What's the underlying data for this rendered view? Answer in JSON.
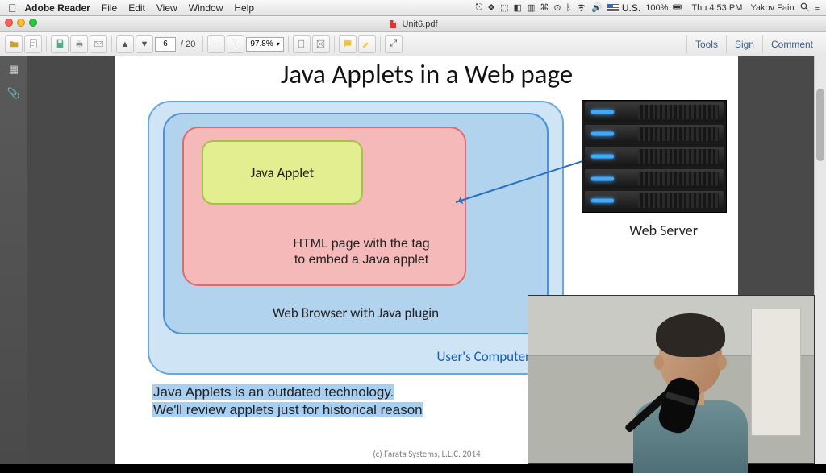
{
  "macmenu": {
    "app": "Adobe Reader",
    "items": [
      "File",
      "Edit",
      "View",
      "Window",
      "Help"
    ],
    "status": {
      "battery": "100%",
      "time": "Thu 4:53 PM",
      "user": "Yakov Fain",
      "input": "U.S."
    }
  },
  "window": {
    "title_doc": "Unit6.pdf"
  },
  "toolbar": {
    "page_current": "6",
    "page_total": "/  20",
    "zoom": "97.8%",
    "right": {
      "tools": "Tools",
      "sign": "Sign",
      "comment": "Comment"
    }
  },
  "slide": {
    "title": "Java Applets in a Web page",
    "applet_box": "Java Applet",
    "html_box_line1": "HTML page with the tag",
    "html_box_line2": "to embed a Java applet",
    "browser_label": "Web Browser with Java plugin",
    "computer_label": "User's Computer",
    "server_label": "Web Server",
    "footnote_line1": "Java Applets is an outdated technology.",
    "footnote_line2": "We'll review applets just for historical reason",
    "copyright": "(c) Farata Systems, L.L.C.  2014"
  }
}
